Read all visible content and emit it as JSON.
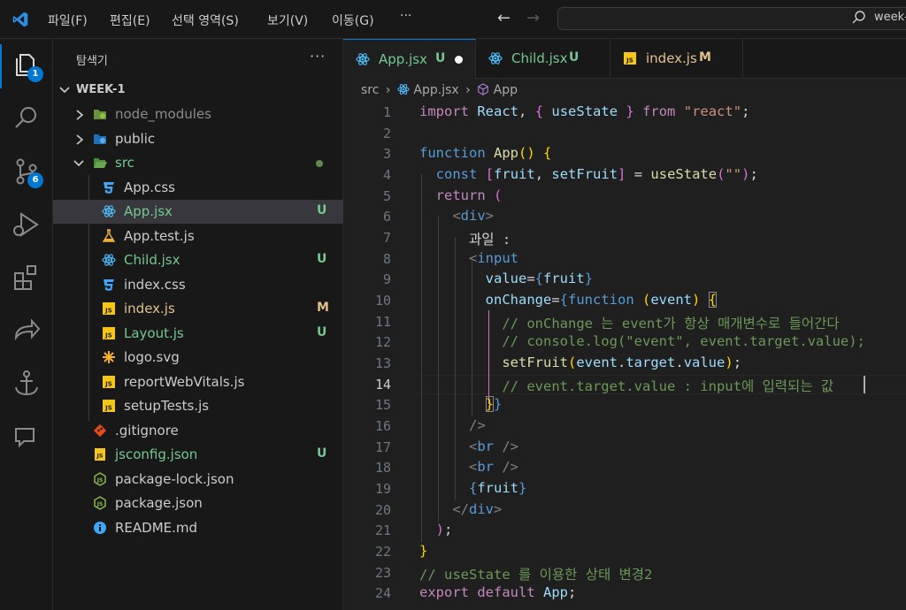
{
  "menu": [
    "파일(F)",
    "편집(E)",
    "선택 영역(S)",
    "보기(V)",
    "이동(G)",
    "···"
  ],
  "search": {
    "text": "week-"
  },
  "activity": {
    "explorer_badge": "1",
    "scm_badge": "6"
  },
  "sidebar": {
    "title": "탐색기",
    "more": "···",
    "folder": "WEEK-1",
    "items": [
      {
        "label": "node_modules",
        "status": ""
      },
      {
        "label": "public",
        "status": ""
      },
      {
        "label": "src",
        "status": ""
      },
      {
        "label": "App.css",
        "status": ""
      },
      {
        "label": "App.jsx",
        "status": "U"
      },
      {
        "label": "App.test.js",
        "status": ""
      },
      {
        "label": "Child.jsx",
        "status": "U"
      },
      {
        "label": "index.css",
        "status": ""
      },
      {
        "label": "index.js",
        "status": "M"
      },
      {
        "label": "Layout.js",
        "status": "U"
      },
      {
        "label": "logo.svg",
        "status": ""
      },
      {
        "label": "reportWebVitals.js",
        "status": ""
      },
      {
        "label": "setupTests.js",
        "status": ""
      },
      {
        "label": ".gitignore",
        "status": ""
      },
      {
        "label": "jsconfig.json",
        "status": "U"
      },
      {
        "label": "package-lock.json",
        "status": ""
      },
      {
        "label": "package.json",
        "status": ""
      },
      {
        "label": "README.md",
        "status": ""
      }
    ]
  },
  "tabs": [
    {
      "label": "App.jsx",
      "status": "U"
    },
    {
      "label": "Child.jsx",
      "status": "U"
    },
    {
      "label": "index.js",
      "status": "M"
    }
  ],
  "breadcrumb": {
    "folder": "src",
    "file": "App.jsx",
    "symbol": "App"
  },
  "editor": {
    "line_numbers": [
      "1",
      "2",
      "3",
      "4",
      "5",
      "6",
      "7",
      "8",
      "9",
      "10",
      "11",
      "12",
      "13",
      "14",
      "15",
      "16",
      "17",
      "18",
      "19",
      "20",
      "21",
      "22",
      "23",
      "24"
    ],
    "current_line": "14",
    "code": {
      "l1": [
        "import",
        "React",
        "{",
        "useState",
        "}",
        "from",
        "\"react\"",
        ";"
      ],
      "l3": [
        "function",
        "App",
        "()",
        "{"
      ],
      "l4": [
        "const",
        "[",
        "fruit",
        ",",
        "setFruit",
        "]",
        "=",
        "useState",
        "(",
        "\"\"",
        ")",
        ";"
      ],
      "l5": [
        "return",
        "("
      ],
      "l6": [
        "<",
        "div",
        ">"
      ],
      "l7": "과일 :",
      "l8": [
        "<",
        "input"
      ],
      "l9": [
        "value",
        "=",
        "{",
        "fruit",
        "}"
      ],
      "l10": [
        "onChange",
        "=",
        "{",
        "function",
        "(",
        "event",
        ")",
        "{"
      ],
      "l11": "// onChange 는 event가 항상 매개변수로 들어간다",
      "l12": "// console.log(\"event\", event.target.value);",
      "l13": [
        "setFruit",
        "(",
        "event",
        ".",
        "target",
        ".",
        "value",
        ")",
        ";"
      ],
      "l14": "// event.target.value : input에 입력되는 값",
      "l15": [
        "}",
        "}"
      ],
      "l16": "/>",
      "l17": [
        "<",
        "br",
        " />"
      ],
      "l18": [
        "<",
        "br",
        " />"
      ],
      "l19": [
        "{",
        "fruit",
        "}"
      ],
      "l20": [
        "</",
        "div",
        ">"
      ],
      "l21": [
        ")",
        ";"
      ],
      "l22": "}",
      "l23": "// useState 를 이용한 상태 변경2",
      "l24": [
        "export",
        "default",
        "App",
        ";"
      ]
    }
  }
}
